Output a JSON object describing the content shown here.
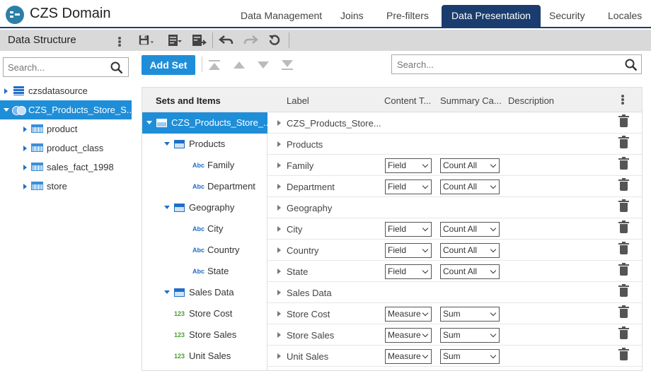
{
  "app": {
    "title": "CZS Domain"
  },
  "tabs": [
    {
      "label": "Data Management"
    },
    {
      "label": "Joins"
    },
    {
      "label": "Pre-filters"
    },
    {
      "label": "Data Presentation"
    },
    {
      "label": "Security"
    },
    {
      "label": "Locales"
    }
  ],
  "active_tab": "Data Presentation",
  "left_panel": {
    "title": "Data Structure",
    "search_placeholder": "Search...",
    "tree": [
      {
        "label": "czsdatasource",
        "icon": "database-icon"
      },
      {
        "label": "CZS_Products_Store_S...",
        "icon": "domain-icon",
        "selected": true
      },
      {
        "label": "product",
        "icon": "table-icon"
      },
      {
        "label": "product_class",
        "icon": "table-icon"
      },
      {
        "label": "sales_fact_1998",
        "icon": "table-icon"
      },
      {
        "label": "store",
        "icon": "table-icon"
      }
    ]
  },
  "actions": {
    "add_set": "Add Set",
    "search_placeholder": "Search..."
  },
  "grid": {
    "headers": {
      "sets": "Sets and Items",
      "label": "Label",
      "content_type": "Content T...",
      "summary": "Summary Ca...",
      "description": "Description"
    },
    "rows": [
      {
        "set_label": "CZS_Products_Store_...",
        "label": "CZS_Products_Store...",
        "type": "domain",
        "content": "",
        "summary": ""
      },
      {
        "set_label": "Products",
        "label": "Products",
        "type": "set",
        "content": "",
        "summary": ""
      },
      {
        "set_label": "Family",
        "label": "Family",
        "type": "abc",
        "content": "Field",
        "summary": "Count All"
      },
      {
        "set_label": "Department",
        "label": "Department",
        "type": "abc",
        "content": "Field",
        "summary": "Count All"
      },
      {
        "set_label": "Geography",
        "label": "Geography",
        "type": "set",
        "content": "",
        "summary": ""
      },
      {
        "set_label": "City",
        "label": "City",
        "type": "abc",
        "content": "Field",
        "summary": "Count All"
      },
      {
        "set_label": "Country",
        "label": "Country",
        "type": "abc",
        "content": "Field",
        "summary": "Count All"
      },
      {
        "set_label": "State",
        "label": "State",
        "type": "abc",
        "content": "Field",
        "summary": "Count All"
      },
      {
        "set_label": "Sales Data",
        "label": "Sales Data",
        "type": "set",
        "content": "",
        "summary": ""
      },
      {
        "set_label": "Store Cost",
        "label": "Store Cost",
        "type": "num",
        "content": "Measure",
        "summary": "Sum"
      },
      {
        "set_label": "Store Sales",
        "label": "Store Sales",
        "type": "num",
        "content": "Measure",
        "summary": "Sum"
      },
      {
        "set_label": "Unit Sales",
        "label": "Unit Sales",
        "type": "num",
        "content": "Measure",
        "summary": "Sum"
      }
    ]
  },
  "badges": {
    "abc": "Abc",
    "num": "123"
  },
  "colors": {
    "accent": "#1f8ed8",
    "header_active": "#1b3c6e",
    "toolbar": "#d9d9d9"
  }
}
